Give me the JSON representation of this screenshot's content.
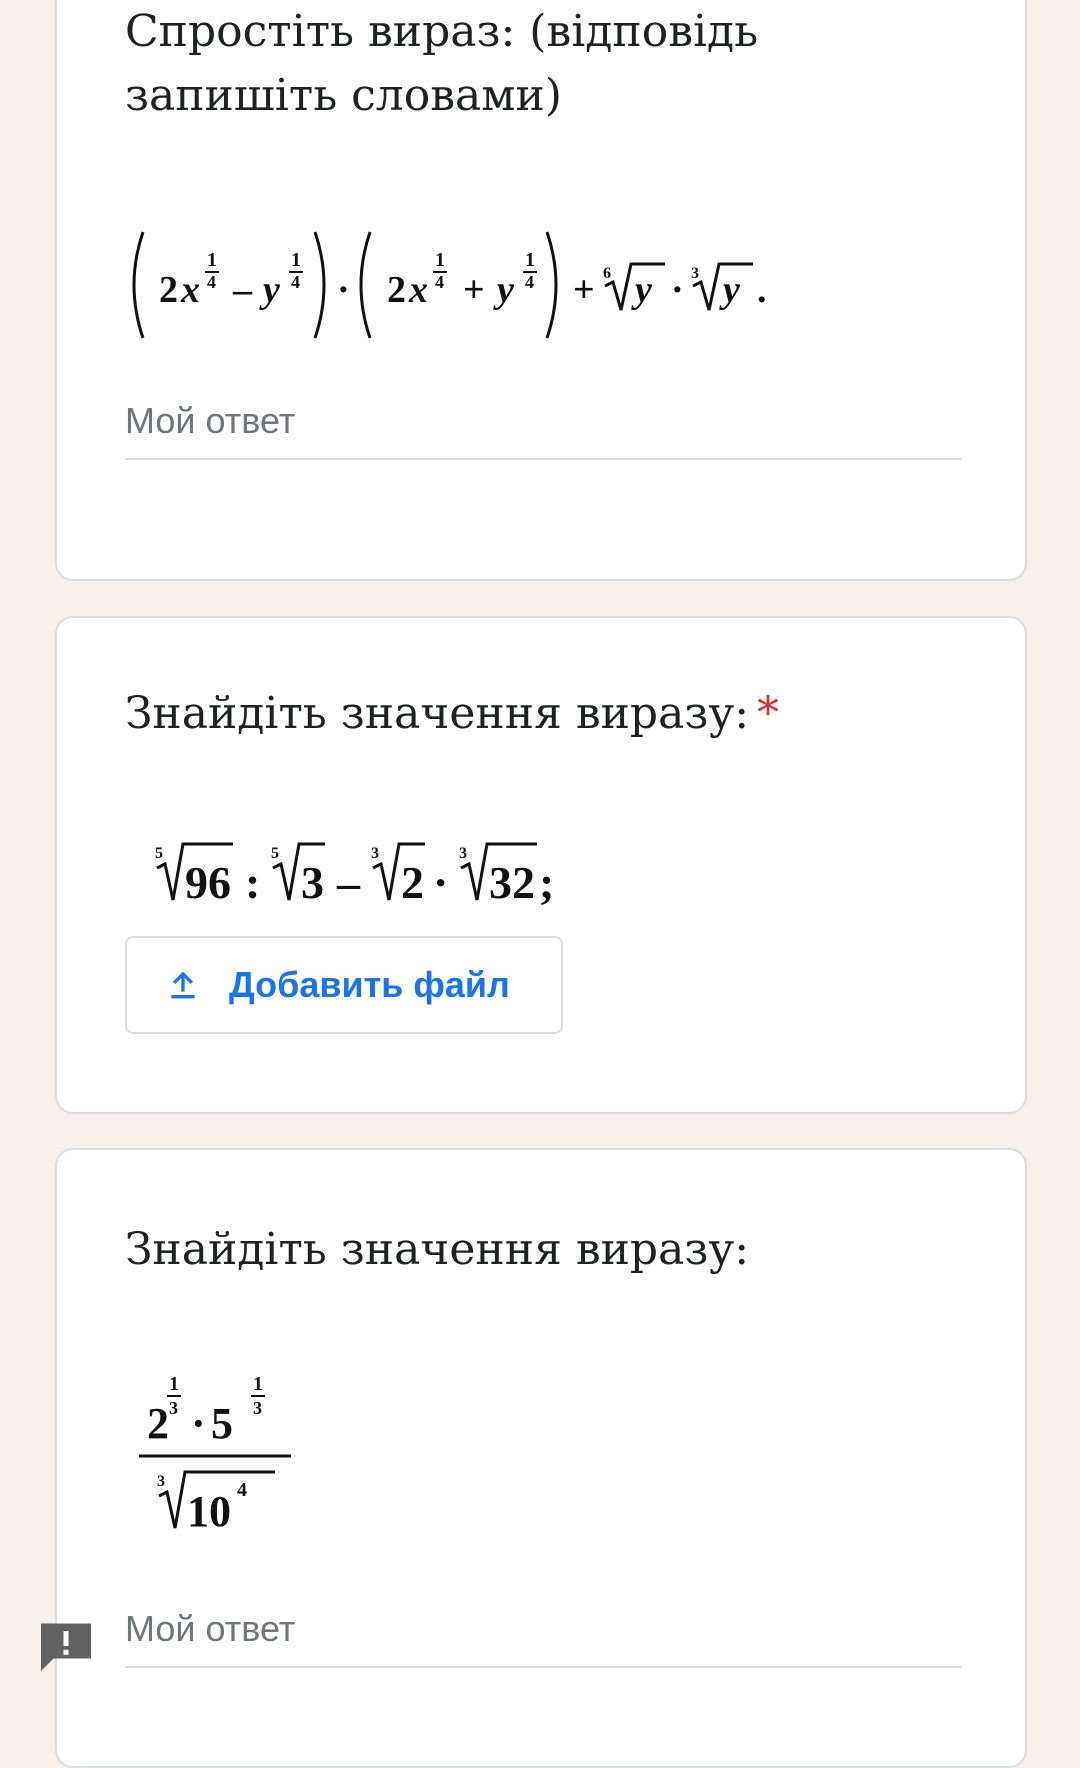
{
  "questions": [
    {
      "title": "Спростіть вираз: (відповідь запишіть словами)",
      "answer_placeholder": "Мой ответ"
    },
    {
      "title": "Знайдіть значення виразу:",
      "required_mark": "*",
      "add_file_label": "Добавить файл"
    },
    {
      "title": "Знайдіть значення виразу:",
      "answer_placeholder": "Мой ответ"
    }
  ],
  "colors": {
    "accent": "#1a73e8",
    "required": "#d93025",
    "card_border": "#dadce0",
    "page_background": "#f8f0eb"
  },
  "icons": [
    "upload-icon",
    "feedback-icon"
  ]
}
